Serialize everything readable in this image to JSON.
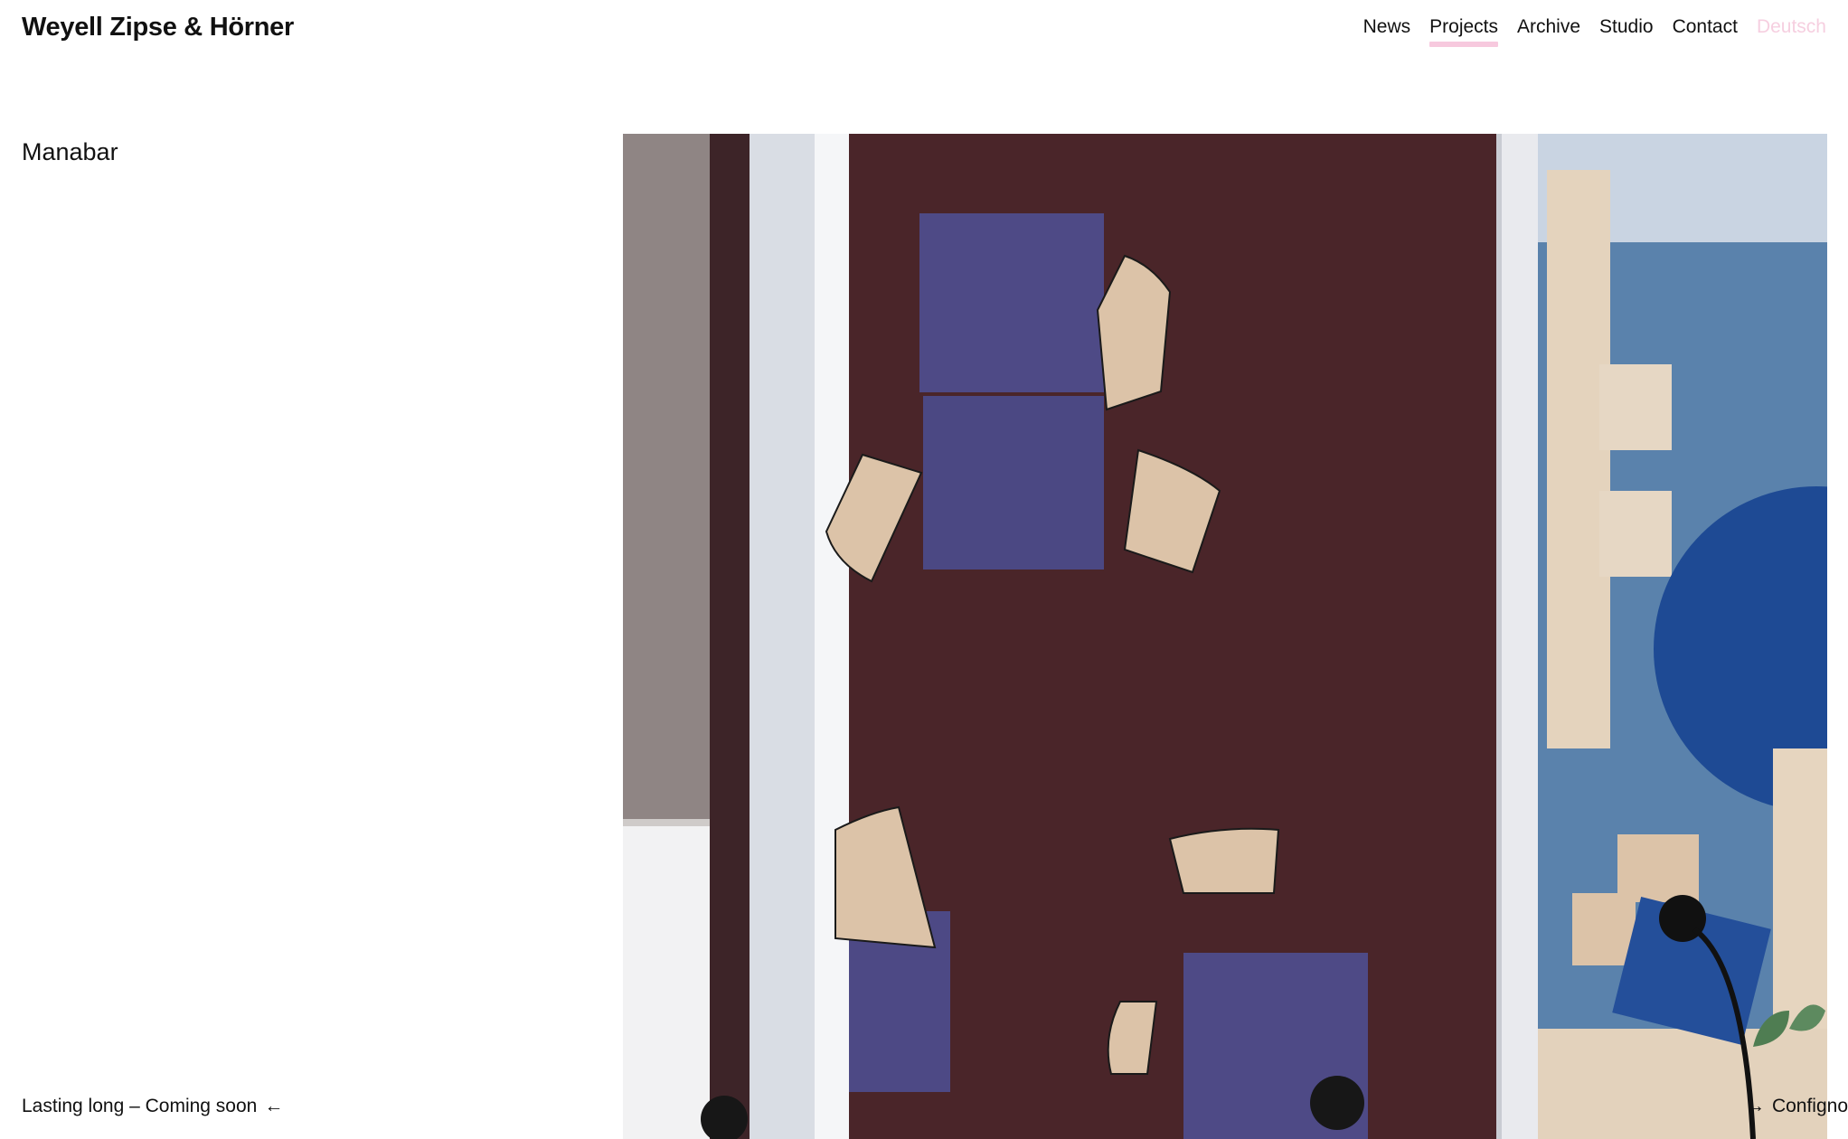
{
  "header": {
    "logo": "Weyell Zipse & Hörner",
    "nav": [
      {
        "label": "News",
        "active": false
      },
      {
        "label": "Projects",
        "active": true
      },
      {
        "label": "Archive",
        "active": false
      },
      {
        "label": "Studio",
        "active": false
      },
      {
        "label": "Contact",
        "active": false
      }
    ],
    "language": "Deutsch"
  },
  "project": {
    "title": "Manabar"
  },
  "pager": {
    "prev_label": "Lasting long – Coming soon",
    "prev_arrow": "←",
    "next_label": "Configno",
    "next_arrow": "→"
  },
  "colors": {
    "accent_underline": "#f7c9de",
    "language_text": "#f6cfe0",
    "floor_maroon": "#4a2529",
    "table_purple": "#4e4a86",
    "chair_beige": "#dcc3a8",
    "floor_blue": "#5a82ac",
    "round_table_blue": "#1e4a94"
  }
}
